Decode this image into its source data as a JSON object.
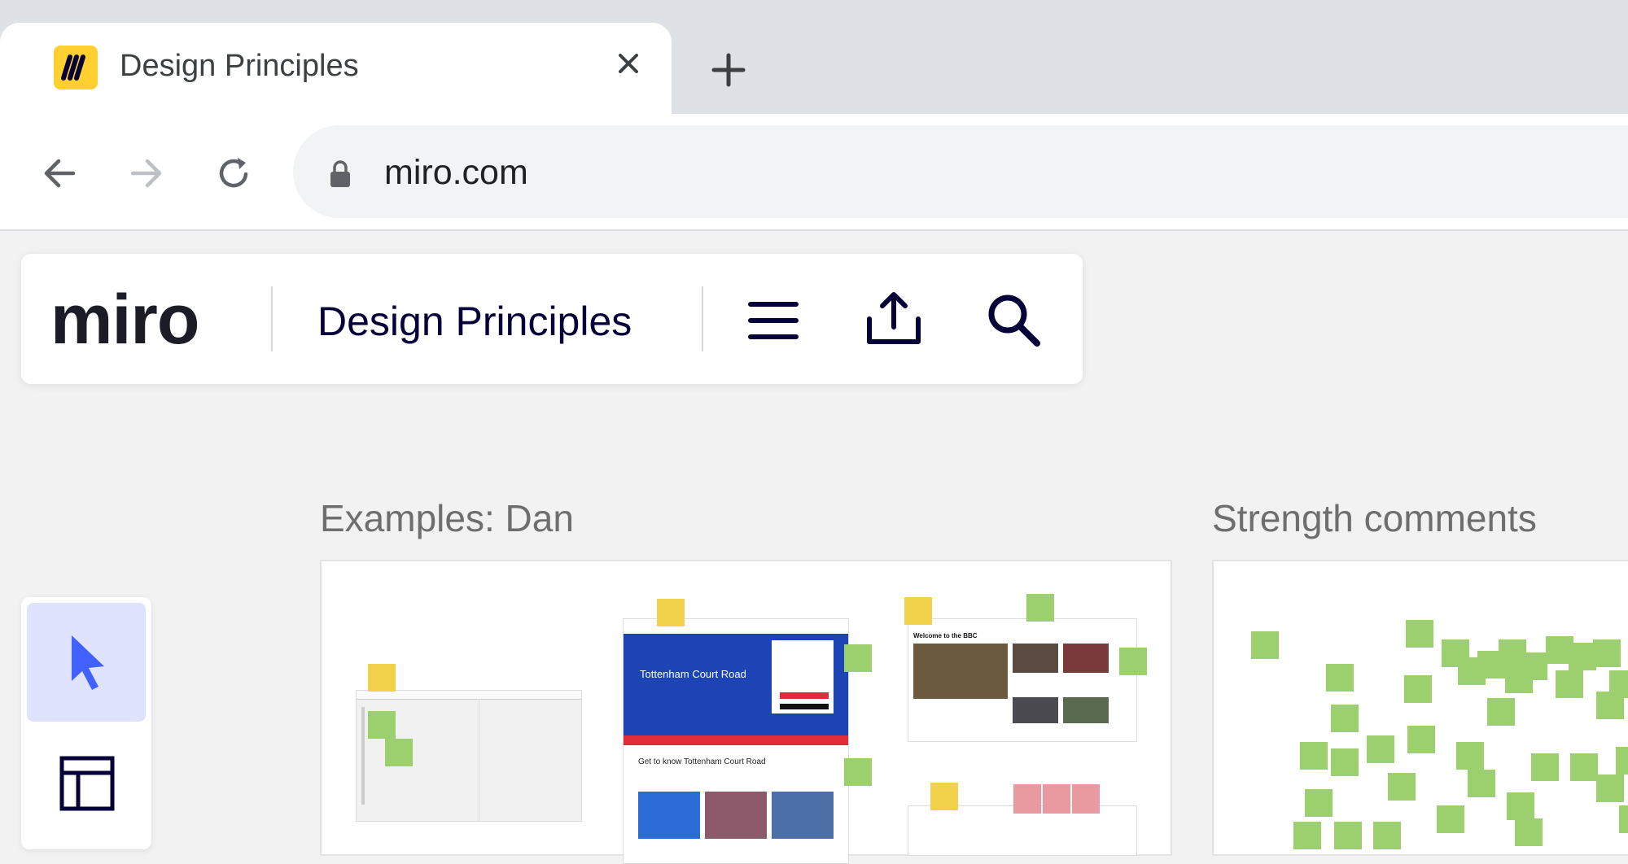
{
  "browser": {
    "tab_title": "Design Principles",
    "url": "miro.com"
  },
  "miro": {
    "logo_text": "miro",
    "board_title": "Design Principles"
  },
  "frames": [
    {
      "label": "Examples: Dan"
    },
    {
      "label": "Strength comments"
    }
  ],
  "thumbnails": {
    "tcr_title": "Tottenham Court Road",
    "tcr_subtitle": "Get to know Tottenham Court Road",
    "bbc_title": "Welcome to the BBC"
  },
  "colors": {
    "miro_yellow": "#ffd02f",
    "sticky_green": "#9ccf6e",
    "sticky_yellow": "#f2d14a",
    "sticky_pink": "#e89aa0",
    "select_active": "#dfe3fe"
  }
}
